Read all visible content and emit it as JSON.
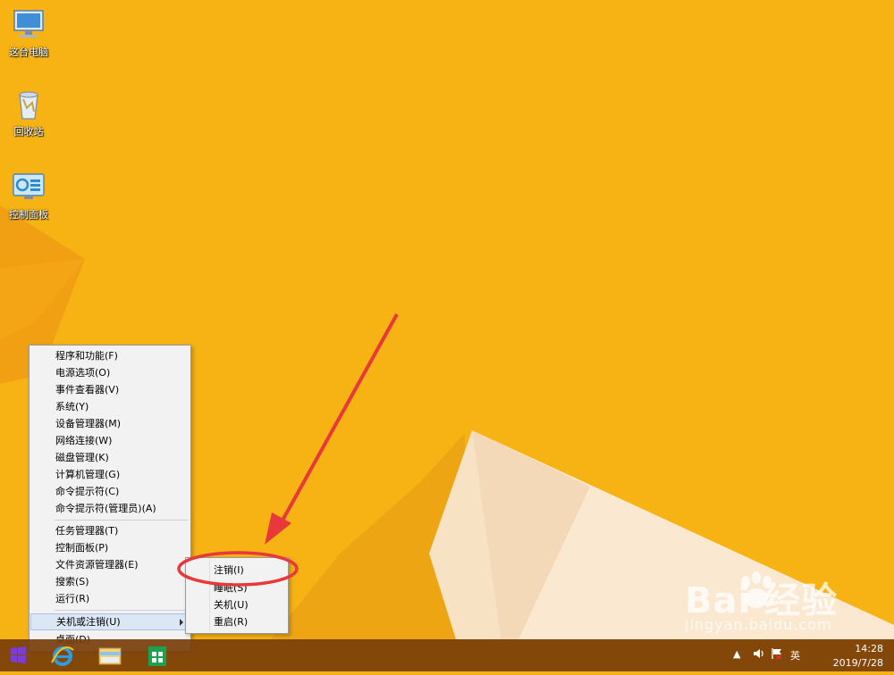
{
  "desktop": {
    "icons": [
      {
        "label": "这台电脑",
        "icon": "computer-icon"
      },
      {
        "label": "回收站",
        "icon": "recycle-bin-icon"
      },
      {
        "label": "控制面板",
        "icon": "control-panel-icon"
      }
    ]
  },
  "winx_menu": {
    "group1": [
      "程序和功能(F)",
      "电源选项(O)",
      "事件查看器(V)",
      "系统(Y)",
      "设备管理器(M)",
      "网络连接(W)",
      "磁盘管理(K)",
      "计算机管理(G)",
      "命令提示符(C)",
      "命令提示符(管理员)(A)"
    ],
    "group2": [
      "任务管理器(T)",
      "控制面板(P)",
      "文件资源管理器(E)",
      "搜索(S)",
      "运行(R)"
    ],
    "group3": [
      "关机或注销(U)",
      "桌面(D)"
    ]
  },
  "shutdown_submenu": {
    "items": [
      "注销(I)",
      "睡眠(S)",
      "关机(U)",
      "重启(R)"
    ]
  },
  "taskbar": {
    "pinned": [
      "internet-explorer-icon",
      "file-explorer-icon",
      "store-icon"
    ],
    "tray": {
      "ime": "英",
      "time": "14:28",
      "date": "2019/7/28"
    }
  },
  "watermark": {
    "brand": "Bai 经验",
    "url": "jingyan.baidu.com"
  },
  "colors": {
    "wallpaper": "#f6b313",
    "highlight_ring": "#e8383a",
    "arrow": "#e8383a"
  }
}
